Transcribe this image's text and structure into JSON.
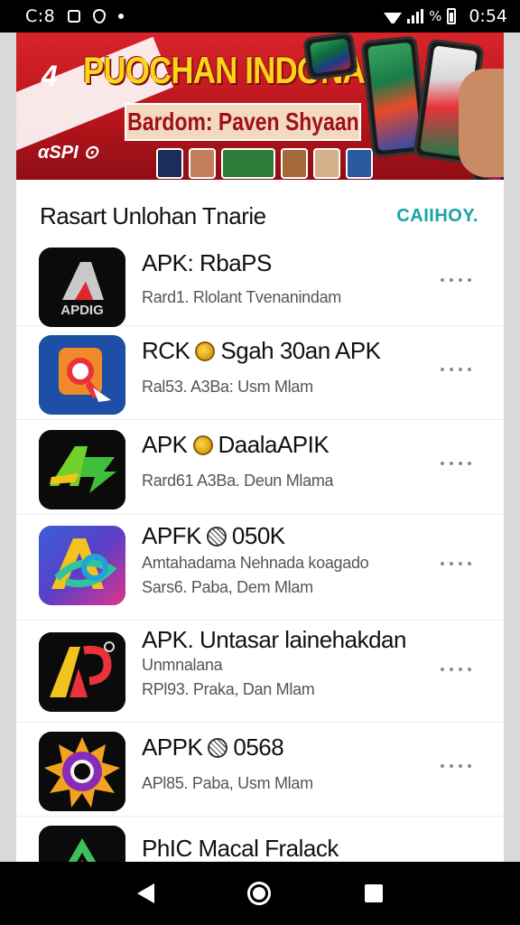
{
  "status_bar": {
    "time_left": "C:8",
    "time_right": "0:54",
    "battery_text": "%"
  },
  "banner": {
    "number": "4",
    "title": "PUOCHAN INDONASIA",
    "subtitle": "Bardom: Paven Shyaan",
    "tag": "αSPI ⊙"
  },
  "section": {
    "title": "Rasart Unlohan Tnarie",
    "link": "CAIIHOY."
  },
  "apps": [
    {
      "name": "APK: RbaPS",
      "badge": "",
      "sub": "",
      "meta": "Rard1. Rlolant Tvenanindam",
      "icon_label": "APDIG",
      "icon": "apdig-app-icon"
    },
    {
      "name": "RCK",
      "badge": "gold",
      "name_after": "Sgah 30an APK",
      "sub": "",
      "meta": "Ral53. A3Ba: Usm Mlam",
      "icon_label": "",
      "icon": "search-pin-app-icon"
    },
    {
      "name": "APK",
      "badge": "gold",
      "name_after": "DaalaAPIK",
      "sub": "",
      "meta": "Rard61 A3Ba. Deun Mlama",
      "icon_label": "",
      "icon": "green-a-app-icon"
    },
    {
      "name": "APFK",
      "badge": "web",
      "name_after": "050K",
      "sub": "Amtahadama Nehnada koagado",
      "meta": "Sars6. Paba, Dem Mlam",
      "icon_label": "",
      "icon": "rainbow-a-app-icon"
    },
    {
      "name": "APK. Untasar lainehakdan",
      "badge": "",
      "sub": "Unmnalana",
      "meta": "RPl93. Praka, Dan Mlam",
      "icon_label": "",
      "icon": "colorful-a-app-icon"
    },
    {
      "name": "APPK",
      "badge": "web",
      "name_after": "0568",
      "sub": "",
      "meta": "APl85. Paba, Usm Mlam",
      "icon_label": "",
      "icon": "sun-app-icon"
    },
    {
      "name": "PhIC Macal Fralack",
      "badge": "",
      "sub": "",
      "meta": "",
      "icon_label": "",
      "icon": "triangle-app-icon"
    }
  ]
}
